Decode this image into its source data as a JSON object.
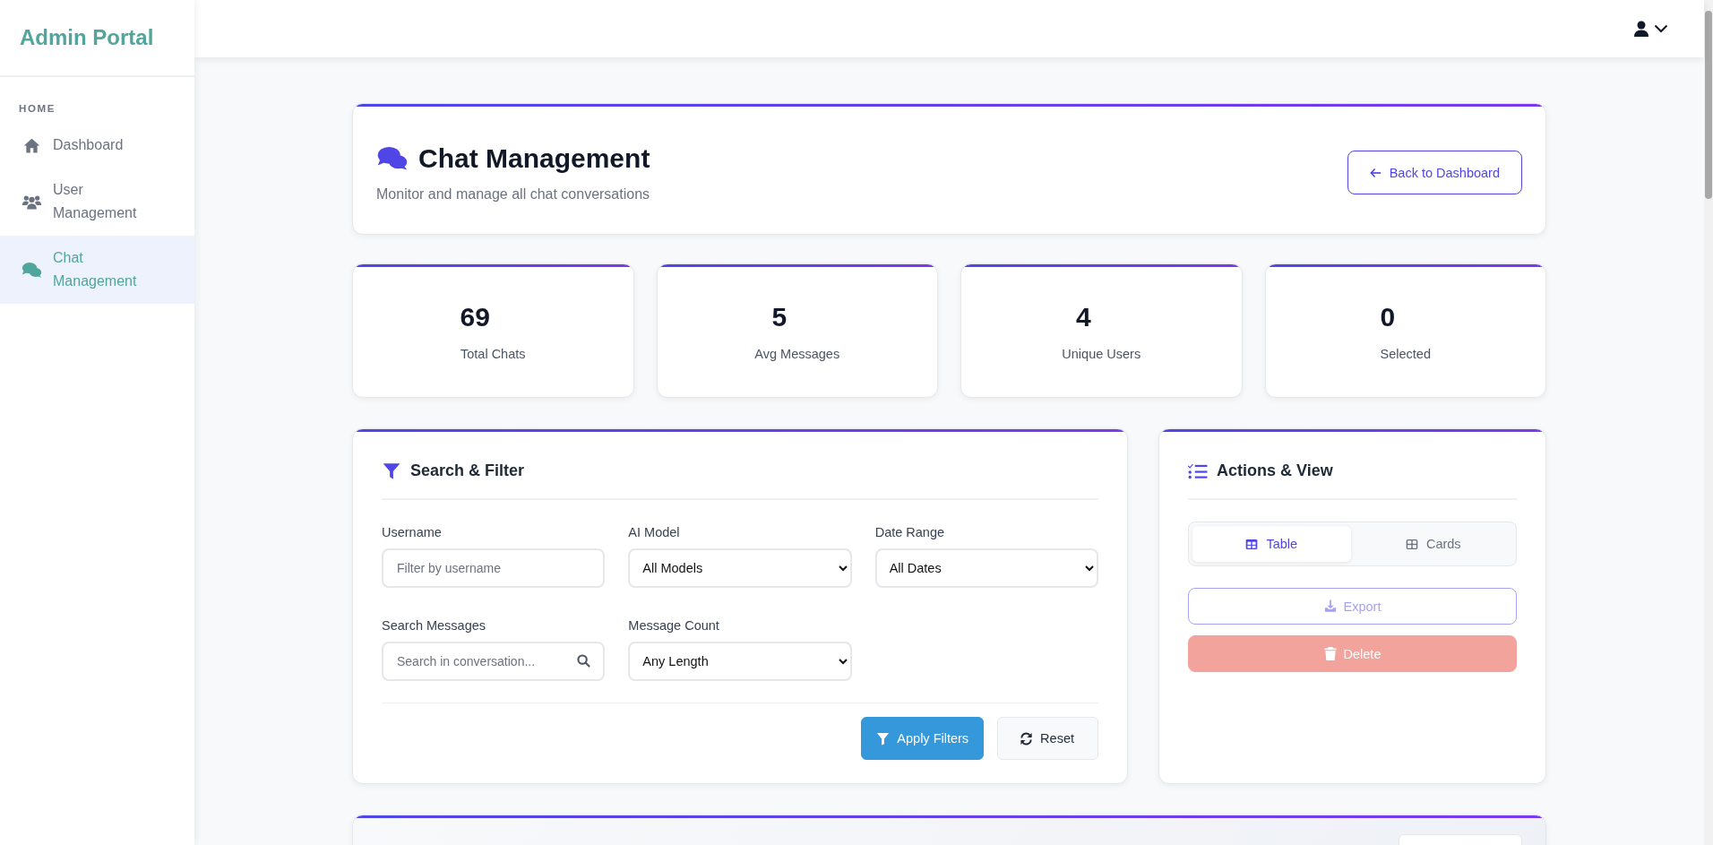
{
  "sidebar": {
    "brand": "Admin Portal",
    "section": "HOME",
    "items": [
      {
        "label": "Dashboard",
        "selected": false
      },
      {
        "label": "User Management",
        "selected": false
      },
      {
        "label": "Chat Management",
        "selected": true
      }
    ]
  },
  "page_header": {
    "title": "Chat Management",
    "subtitle": "Monitor and manage all chat conversations",
    "back_button": "Back to Dashboard"
  },
  "stats": [
    {
      "value": "69",
      "label": "Total Chats"
    },
    {
      "value": "5",
      "label": "Avg Messages"
    },
    {
      "value": "4",
      "label": "Unique Users"
    },
    {
      "value": "0",
      "label": "Selected"
    }
  ],
  "filter": {
    "title": "Search & Filter",
    "fields": [
      {
        "kind": "text",
        "label": "Username",
        "placeholder": "Filter by username"
      },
      {
        "kind": "select",
        "label": "AI Model",
        "value": "All Models"
      },
      {
        "kind": "select",
        "label": "Date Range",
        "value": "All Dates"
      },
      {
        "kind": "search",
        "label": "Search Messages",
        "placeholder": "Search in conversation..."
      },
      {
        "kind": "select",
        "label": "Message Count",
        "value": "Any Length"
      }
    ],
    "buttons": [
      {
        "kind": "primary",
        "label": "Apply Filters"
      },
      {
        "kind": "secondary",
        "label": "Reset"
      }
    ]
  },
  "actions": {
    "title": "Actions & View",
    "view_tabs": [
      {
        "label": "Table",
        "selected": true
      },
      {
        "label": "Cards",
        "selected": false
      }
    ],
    "buttons": [
      {
        "kind": "export",
        "label": "Export",
        "disabled": true
      },
      {
        "kind": "delete",
        "label": "Delete",
        "disabled": true
      }
    ]
  }
}
